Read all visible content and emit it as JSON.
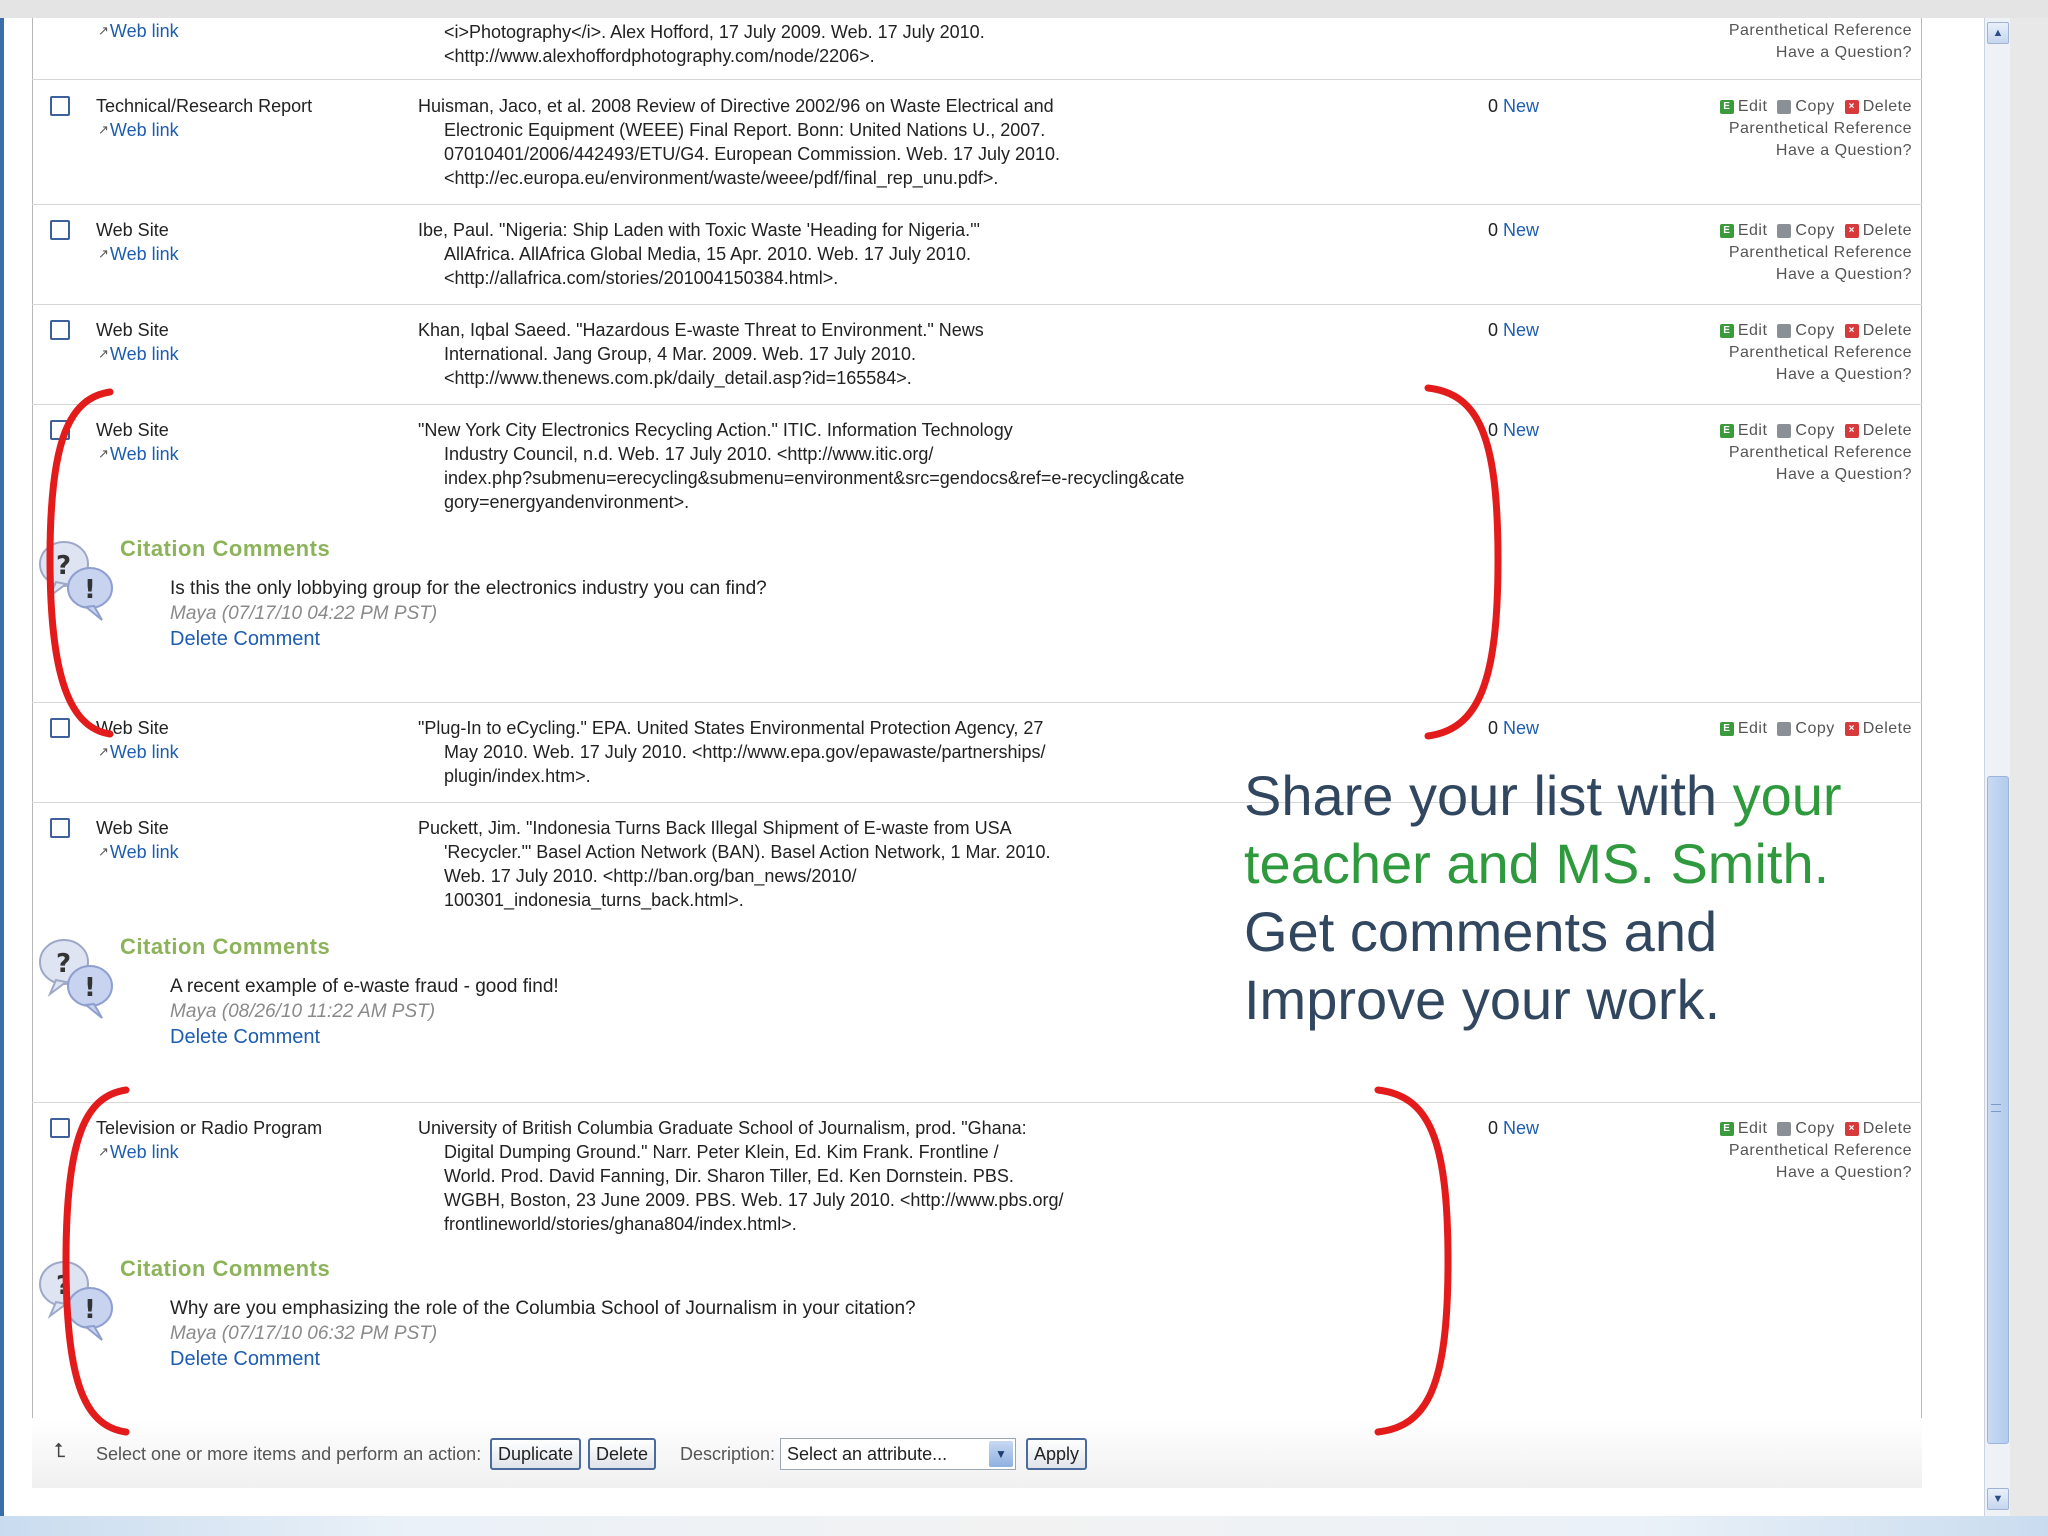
{
  "rows": [
    {
      "type": "",
      "weblink": "Web link",
      "cite_lines": [
        "<i>Photography</i>. Alex Hofford, 17 July 2009. Web. 17 July 2010.",
        "<http://www.alexhoffordphotography.com/node/2206>."
      ],
      "count": "",
      "new": "",
      "actions": [
        "Parenthetical Reference",
        "Have a Question?"
      ]
    },
    {
      "type": "Technical/Research Report",
      "weblink": "Web link",
      "cite_lines": [
        "Huisman, Jaco, et al. 2008 Review of Directive 2002/96 on Waste Electrical and",
        "Electronic Equipment (WEEE) Final Report. Bonn: United Nations U., 2007.",
        "07010401/2006/442493/ETU/G4. European Commission. Web. 17 July 2010.",
        "<http://ec.europa.eu/environment/waste/weee/pdf/final_rep_unu.pdf>."
      ],
      "count": "0",
      "new": "New"
    },
    {
      "type": "Web Site",
      "weblink": "Web link",
      "cite_lines": [
        "Ibe, Paul. \"Nigeria: Ship Laden with Toxic Waste 'Heading for Nigeria.'\"",
        "AllAfrica. AllAfrica Global Media, 15 Apr. 2010. Web. 17 July 2010.",
        "<http://allafrica.com/stories/201004150384.html>."
      ],
      "count": "0",
      "new": "New"
    },
    {
      "type": "Web Site",
      "weblink": "Web link",
      "cite_lines": [
        "Khan, Iqbal Saeed. \"Hazardous E-waste Threat to Environment.\" News",
        "International. Jang Group, 4 Mar. 2009. Web. 17 July 2010.",
        "<http://www.thenews.com.pk/daily_detail.asp?id=165584>."
      ],
      "count": "0",
      "new": "New"
    },
    {
      "type": "Web Site",
      "weblink": "Web link",
      "cite_lines": [
        "\"New York City Electronics Recycling Action.\" ITIC. Information Technology",
        "Industry Council, n.d. Web. 17 July 2010. <http://www.itic.org/",
        "index.php?submenu=erecycling&submenu=environment&src=gendocs&ref=e-recycling&cate",
        "gory=energyandenvironment>."
      ],
      "count": "0",
      "new": "New"
    },
    {
      "type": "Web Site",
      "weblink": "Web link",
      "cite_lines": [
        "\"Plug-In to eCycling.\" EPA. United States Environmental Protection Agency, 27",
        "May 2010. Web. 17 July 2010. <http://www.epa.gov/epawaste/partnerships/",
        "plugin/index.htm>."
      ],
      "count": "0",
      "new": "New"
    },
    {
      "type": "Web Site",
      "weblink": "Web link",
      "cite_lines": [
        "Puckett, Jim. \"Indonesia Turns Back Illegal Shipment of E-waste from USA",
        "'Recycler.'\" Basel Action Network (BAN). Basel Action Network, 1 Mar. 2010.",
        "Web. 17 July 2010. <http://ban.org/ban_news/2010/",
        "100301_indonesia_turns_back.html>."
      ],
      "count": "",
      "new": ""
    },
    {
      "type": "Television or Radio Program",
      "weblink": "Web link",
      "cite_lines": [
        "University of British Columbia Graduate School of Journalism, prod. \"Ghana:",
        "Digital Dumping Ground.\" Narr. Peter Klein, Ed. Kim Frank. Frontline /",
        "World. Prod. David Fanning, Dir. Sharon Tiller, Ed. Ken Dornstein. PBS.",
        "WGBH, Boston, 23 June 2009. PBS. Web. 17 July 2010. <http://www.pbs.org/",
        "frontlineworld/stories/ghana804/index.html>."
      ],
      "count": "0",
      "new": "New"
    }
  ],
  "action_labels": {
    "edit": "Edit",
    "copy": "Copy",
    "delete": "Delete",
    "parenthetical": "Parenthetical Reference",
    "question": "Have a Question?"
  },
  "comments": [
    {
      "title": "Citation Comments",
      "text": "Is this the only lobbying group for the electronics industry you can find?",
      "meta": "Maya (07/17/10 04:22 PM PST)",
      "delete": "Delete Comment"
    },
    {
      "title": "Citation Comments",
      "text": "A recent example of e-waste fraud - good find!",
      "meta": "Maya (08/26/10 11:22 AM PST)",
      "delete": "Delete Comment"
    },
    {
      "title": "Citation Comments",
      "text": "Why are you emphasizing the role of the Columbia School of Journalism in your citation?",
      "meta": "Maya (07/17/10 06:32 PM PST)",
      "delete": "Delete Comment"
    }
  ],
  "footer": {
    "hint": "Select one or more items and perform an action:",
    "duplicate": "Duplicate",
    "delete": "Delete",
    "description_label": "Description:",
    "select_value": "Select an attribute...",
    "apply": "Apply"
  },
  "overlay": {
    "part1": "Share your list with ",
    "part2": "your teacher and MS. Smith.",
    "part3": "Get comments and Improve your work."
  },
  "colors": {
    "link": "#1d5db0",
    "comment_title": "#8cb35a",
    "bracket": "#e31b1b",
    "overlay_text": "#31465f",
    "overlay_highlight": "#2f9a3d"
  }
}
